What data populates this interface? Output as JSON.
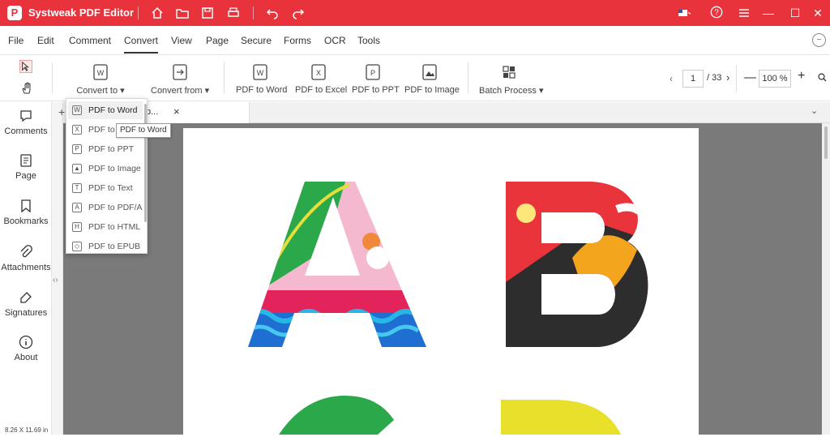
{
  "app": {
    "title": "Systweak PDF Editor",
    "logo_letter": "P"
  },
  "menu": {
    "items": [
      "File",
      "Edit",
      "Comment",
      "Convert",
      "View",
      "Page",
      "Secure",
      "Forms",
      "OCR",
      "Tools"
    ],
    "active": "Convert"
  },
  "toolbar": {
    "convert_to": "Convert to",
    "convert_from": "Convert from",
    "pdf_to_word": "PDF to Word",
    "pdf_to_excel": "PDF to Excel",
    "pdf_to_ppt": "PDF to PPT",
    "pdf_to_image": "PDF to Image",
    "batch_process": "Batch Process",
    "page_current": "1",
    "page_total": "/ 33",
    "zoom": "100 %"
  },
  "sidebar": {
    "items": [
      "Comments",
      "Page",
      "Bookmarks",
      "Attachments",
      "Signatures",
      "About"
    ],
    "page_size": "8.26 X 11.69 in"
  },
  "tab": {
    "label": "p...",
    "close": "×"
  },
  "dropdown": {
    "items": [
      {
        "label": "PDF to Word",
        "icon": "W"
      },
      {
        "label": "PDF to",
        "icon": "X"
      },
      {
        "label": "PDF to PPT",
        "icon": "P"
      },
      {
        "label": "PDF to Image",
        "icon": "▲"
      },
      {
        "label": "PDF to Text",
        "icon": "T"
      },
      {
        "label": "PDF to PDF/A",
        "icon": "A"
      },
      {
        "label": "PDF to HTML",
        "icon": "H"
      },
      {
        "label": "PDF to EPUB",
        "icon": "◇"
      }
    ]
  },
  "tooltip": "PDF to Word",
  "colors": {
    "titlebar": "#e8333c",
    "viewer_bg": "#7a7a7a"
  }
}
